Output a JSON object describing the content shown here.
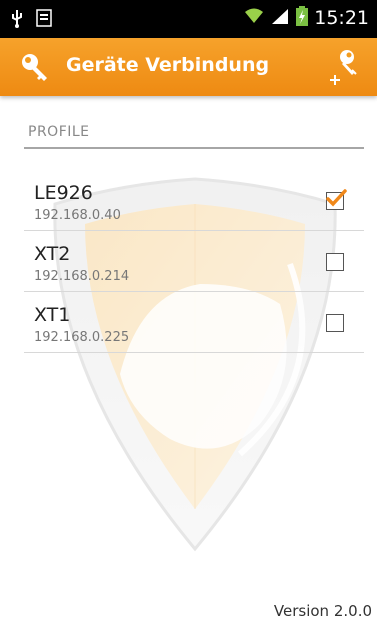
{
  "status_bar": {
    "time": "15:21",
    "icons": [
      "usb-icon",
      "storage-icon",
      "wifi-icon",
      "signal-icon",
      "battery-charging-icon"
    ]
  },
  "action_bar": {
    "title": "Geräte Verbindung",
    "left_icon": "key-icon",
    "add_icon": "add-key-icon",
    "color": "#f39c1f"
  },
  "section": {
    "header": "PROFILE"
  },
  "profiles": [
    {
      "name": "LE926",
      "ip": "192.168.0.40",
      "checked": true
    },
    {
      "name": "XT2",
      "ip": "192.168.0.214",
      "checked": false
    },
    {
      "name": "XT1",
      "ip": "192.168.0.225",
      "checked": false
    }
  ],
  "footer": {
    "version": "Version 2.0.0"
  },
  "colors": {
    "accent": "#f39c1f",
    "check": "#f0881a"
  }
}
